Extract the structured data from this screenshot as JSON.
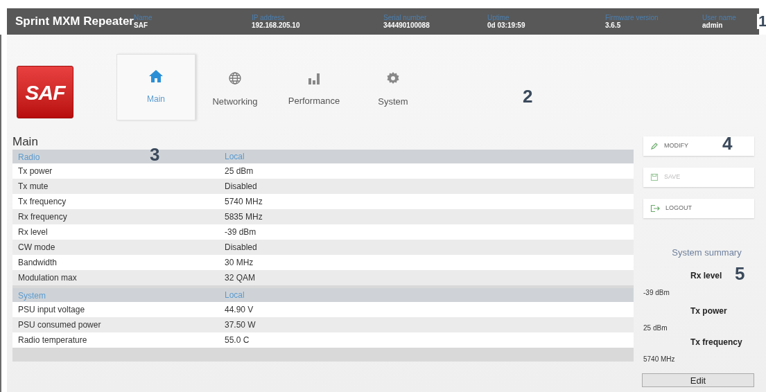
{
  "top_bar": {
    "title": "Sprint MXM Repeater",
    "fields": [
      {
        "label": "Name",
        "value": "SAF"
      },
      {
        "label": "IP address",
        "value": "192.168.205.10"
      },
      {
        "label": "Serial number",
        "value": "344490100088"
      },
      {
        "label": "Uptime",
        "value": "0d 03:19:59"
      },
      {
        "label": "Firmware version",
        "value": "3.6.5"
      },
      {
        "label": "User name",
        "value": "admin"
      }
    ]
  },
  "logo": {
    "text": "SAF"
  },
  "tabs": [
    {
      "label": "Main",
      "selected": true
    },
    {
      "label": "Networking",
      "selected": false
    },
    {
      "label": "Performance",
      "selected": false
    },
    {
      "label": "System",
      "selected": false
    }
  ],
  "main": {
    "title": "Main",
    "sections": [
      {
        "header": "Radio",
        "column": "Local",
        "rows": [
          {
            "label": "Tx power",
            "value": "25 dBm"
          },
          {
            "label": "Tx mute",
            "value": "Disabled"
          },
          {
            "label": "Tx frequency",
            "value": "5740 MHz"
          },
          {
            "label": "Rx frequency",
            "value": "5835 MHz"
          },
          {
            "label": "Rx level",
            "value": "-39 dBm"
          },
          {
            "label": "CW mode",
            "value": "Disabled"
          },
          {
            "label": "Bandwidth",
            "value": "30 MHz"
          },
          {
            "label": "Modulation max",
            "value": "32 QAM"
          }
        ]
      },
      {
        "header": "System",
        "column": "Local",
        "rows": [
          {
            "label": "PSU input voltage",
            "value": "44.90 V"
          },
          {
            "label": "PSU consumed power",
            "value": "37.50 W"
          },
          {
            "label": "Radio temperature",
            "value": "55.0 C"
          }
        ]
      }
    ]
  },
  "actions": [
    {
      "label": "MODIFY",
      "disabled": false
    },
    {
      "label": "SAVE",
      "disabled": true
    },
    {
      "label": "LOGOUT",
      "disabled": false
    }
  ],
  "summary": {
    "title": "System summary",
    "items": [
      {
        "label": "Rx level",
        "value": "-39 dBm"
      },
      {
        "label": "Tx power",
        "value": "25 dBm"
      },
      {
        "label": "Tx frequency",
        "value": "5740 MHz"
      }
    ],
    "edit_button": "Edit"
  },
  "callouts": [
    "1",
    "2",
    "3",
    "4",
    "5"
  ]
}
